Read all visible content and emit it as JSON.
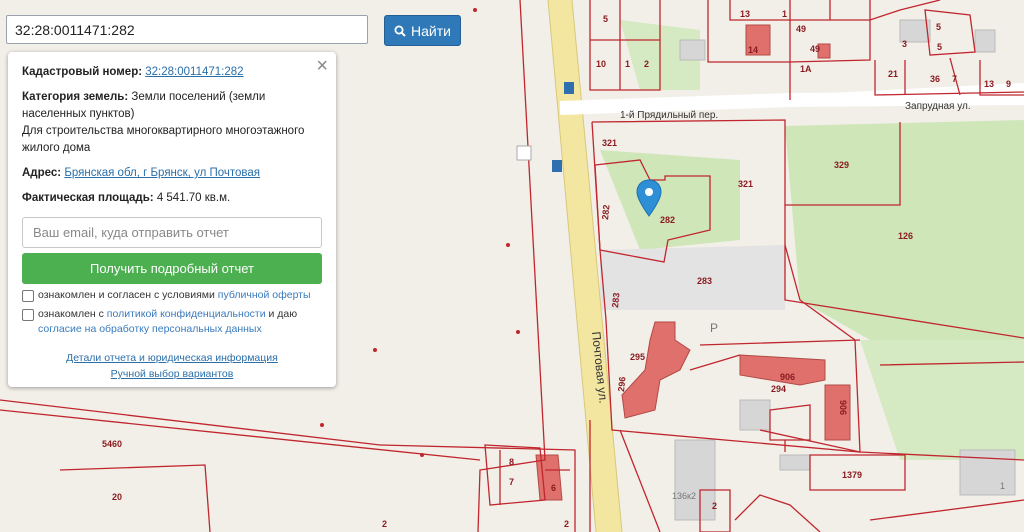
{
  "search": {
    "value": "32:28:0011471:282",
    "button_label": "Найти"
  },
  "panel": {
    "close_symbol": "×",
    "cadastral_label": "Кадастровый номер:",
    "cadastral_value": "32:28:0011471:282",
    "category_label": "Категория земель:",
    "category_value": "Земли поселений (земли населенных пунктов)",
    "usage": "Для строительства многоквартирного многоэтажного жилого дома",
    "address_label": "Адрес:",
    "address_value": "Брянская обл, г Брянск, ул Почтовая",
    "area_label": "Фактическая площадь:",
    "area_value": "4 541.70 кв.м.",
    "email_placeholder": "Ваш email, куда отправить отчет",
    "report_button": "Получить подробный отчет",
    "consent1_prefix": "ознакомлен и согласен с условиями ",
    "consent1_link": "публичной оферты",
    "consent2_prefix": "ознакомлен с ",
    "consent2_link": "политикой конфиденциальности",
    "consent2_middle": " и даю ",
    "consent2_link2": "согласие на обработку персональных данных",
    "details_link": "Детали отчета и юридическая информация",
    "manual_link": "Ручной выбор вариантов"
  },
  "map": {
    "street_labels": [
      "Почтовая ул.",
      "1-й Прядильный пер.",
      "Запрудная ул."
    ],
    "parcel_labels": [
      "5",
      "13",
      "1",
      "49",
      "49",
      "14",
      "10",
      "1",
      "2",
      "1А",
      "3",
      "5",
      "5",
      "21",
      "36",
      "7",
      "13",
      "9",
      "321",
      "329",
      "321",
      "282",
      "282",
      "126",
      "283",
      "283",
      "295",
      "296",
      "294",
      "906",
      "906",
      "5460",
      "20",
      "8",
      "7",
      "6",
      "1379",
      "2",
      "2",
      "136к2",
      "1",
      "2",
      "Р"
    ],
    "colors": {
      "background": "#f2efe9",
      "parcel": "#c0262d",
      "building": "#e0706b",
      "green": "#cfe6b8",
      "road": "#f3e6a0",
      "marker": "#2f8fd6"
    }
  }
}
